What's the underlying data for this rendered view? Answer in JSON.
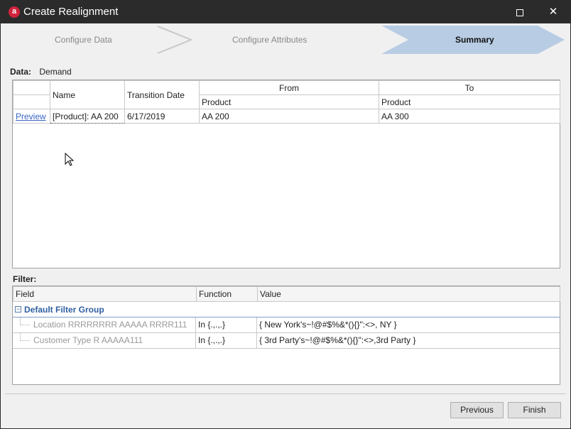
{
  "window": {
    "title": "Create Realignment",
    "app_icon_letter": "a"
  },
  "steps": [
    {
      "label": "Configure Data",
      "active": false
    },
    {
      "label": "Configure Attributes",
      "active": false
    },
    {
      "label": "Summary",
      "active": true
    }
  ],
  "data_section": {
    "key": "Data:",
    "value": "Demand"
  },
  "realign_table": {
    "headers": {
      "name": "Name",
      "transition_date": "Transition Date",
      "from": "From",
      "to": "To",
      "from_sub": "Product",
      "to_sub": "Product"
    },
    "rows": [
      {
        "preview": "Preview",
        "name": "[Product]: AA 200",
        "transition_date": "6/17/2019",
        "from": "AA 200",
        "to": "AA 300"
      }
    ]
  },
  "filter": {
    "label": "Filter:",
    "headers": {
      "field": "Field",
      "function": "Function",
      "value": "Value"
    },
    "group": "Default Filter Group",
    "rows": [
      {
        "field": "Location RRRRRRRR AAAAA RRRR111",
        "function": "In {.,.,.}",
        "value": "{ New York's~!@#$%&*(){}\":<>, NY }"
      },
      {
        "field": "Customer Type R AAAAA111",
        "function": "In {.,.,.}",
        "value": "{ 3rd Party's~!@#$%&*(){}\":<>,3rd Party }"
      }
    ]
  },
  "buttons": {
    "previous": "Previous",
    "finish": "Finish"
  },
  "colors": {
    "titlebar": "#2b2b2b",
    "active_step": "#b8cce4",
    "brand": "#d0233c",
    "link": "#3a66c4"
  }
}
